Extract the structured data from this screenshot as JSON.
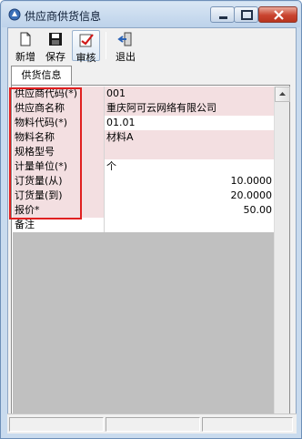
{
  "window": {
    "title": "供应商供货信息"
  },
  "toolbar": {
    "new_label": "新增",
    "save_label": "保存",
    "audit_label": "审核",
    "exit_label": "退出"
  },
  "tabs": [
    {
      "label": "供货信息"
    }
  ],
  "grid": {
    "rows": [
      {
        "label": "供应商代码(*)",
        "value": "001",
        "style": "req"
      },
      {
        "label": "供应商名称",
        "value": "重庆阿可云网络有限公司",
        "style": "req"
      },
      {
        "label": "物料代码(*)",
        "value": "01.01",
        "style": "opt"
      },
      {
        "label": "物料名称",
        "value": "材料A",
        "style": "req"
      },
      {
        "label": "规格型号",
        "value": "",
        "style": "req"
      },
      {
        "label": "计量单位(*)",
        "value": "个",
        "style": "opt"
      },
      {
        "label": "订货量(从)",
        "value": "10.0000",
        "style": "opt",
        "numeric": true
      },
      {
        "label": "订货量(到)",
        "value": "20.0000",
        "style": "opt",
        "numeric": true
      },
      {
        "label": "报价*",
        "value": "50.00",
        "style": "opt",
        "numeric": true
      },
      {
        "label": "备注",
        "value": "",
        "style": "plain"
      }
    ]
  },
  "colors": {
    "required_bg": "#f3dfe1",
    "highlight": "#e02020",
    "grid_empty": "#c0c0c0"
  }
}
